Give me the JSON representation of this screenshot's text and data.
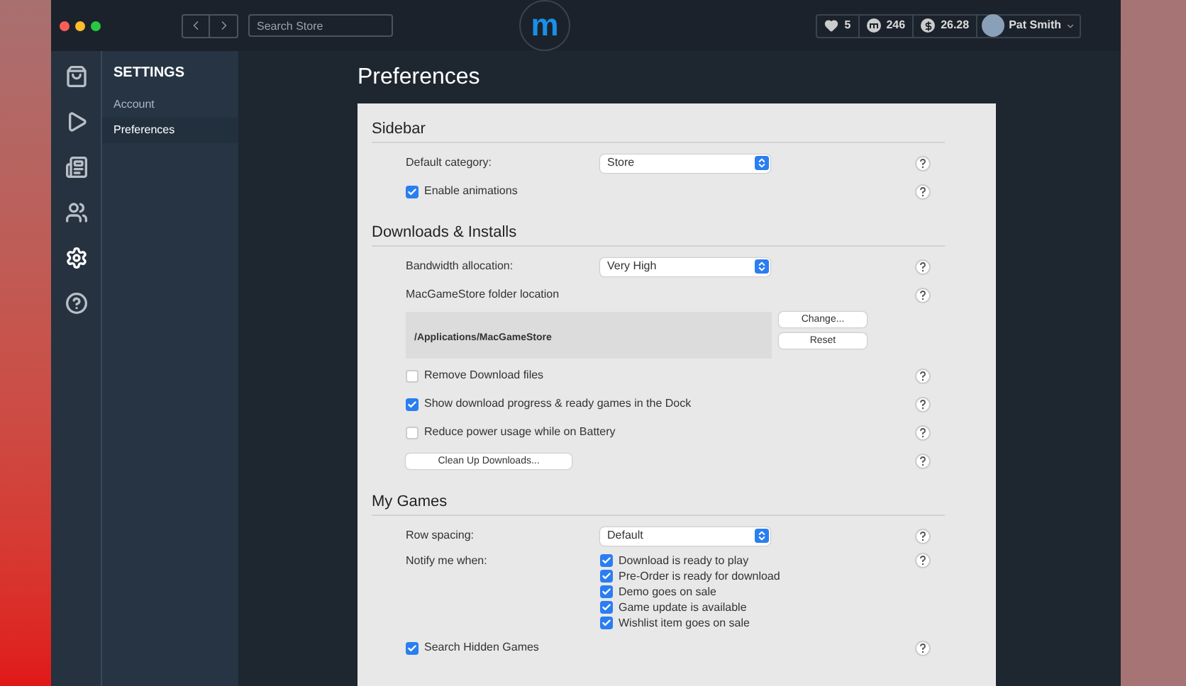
{
  "toolbar": {
    "search": {
      "placeholder": "Search Store"
    },
    "logo": "m",
    "stats": [
      {
        "value": "5"
      },
      {
        "value": "246"
      },
      {
        "value": "26.28"
      }
    ],
    "user": {
      "name": "Pat Smith"
    }
  },
  "rail": [
    {
      "selected": false
    },
    {
      "selected": false
    },
    {
      "selected": false
    },
    {
      "selected": false
    },
    {
      "selected": true
    },
    {
      "selected": false
    }
  ],
  "settings_nav": {
    "title": "SETTINGS",
    "items": [
      {
        "label": "Account",
        "selected": false
      },
      {
        "label": "Preferences",
        "selected": true
      }
    ]
  },
  "page_title": "Preferences",
  "sections": [
    {
      "title": "Sidebar",
      "rows": [
        {
          "kind": "select",
          "label": "Default category:",
          "value": "Store"
        },
        {
          "kind": "checkbox",
          "label": "Enable animations",
          "checked": true
        }
      ]
    },
    {
      "title": "Downloads & Installs",
      "rows": [
        {
          "kind": "select",
          "label": "Bandwidth allocation:",
          "value": "Very High"
        },
        {
          "kind": "text",
          "label": "MacGameStore folder location"
        },
        {
          "kind": "folder",
          "path": "/Applications/MacGameStore",
          "buttons": [
            "Change...",
            "Reset"
          ]
        },
        {
          "kind": "checkbox",
          "label": "Remove Download files",
          "checked": false
        },
        {
          "kind": "checkbox",
          "label": "Show download progress & ready games in the Dock",
          "checked": true
        },
        {
          "kind": "checkbox",
          "label": "Reduce power usage while on Battery",
          "checked": false
        },
        {
          "kind": "button",
          "label": "Clean Up Downloads..."
        }
      ]
    },
    {
      "title": "My Games",
      "rows": [
        {
          "kind": "select",
          "label": "Row spacing:",
          "value": "Default"
        },
        {
          "kind": "checklist",
          "label": "Notify me when:",
          "items": [
            {
              "label": "Download is ready to play",
              "checked": true
            },
            {
              "label": "Pre-Order is ready for download",
              "checked": true
            },
            {
              "label": "Demo goes on sale",
              "checked": true
            },
            {
              "label": "Game update is available",
              "checked": true
            },
            {
              "label": "Wishlist item goes on sale",
              "checked": true
            }
          ]
        },
        {
          "kind": "checkbox",
          "label": "Search Hidden Games",
          "checked": true
        }
      ]
    }
  ]
}
